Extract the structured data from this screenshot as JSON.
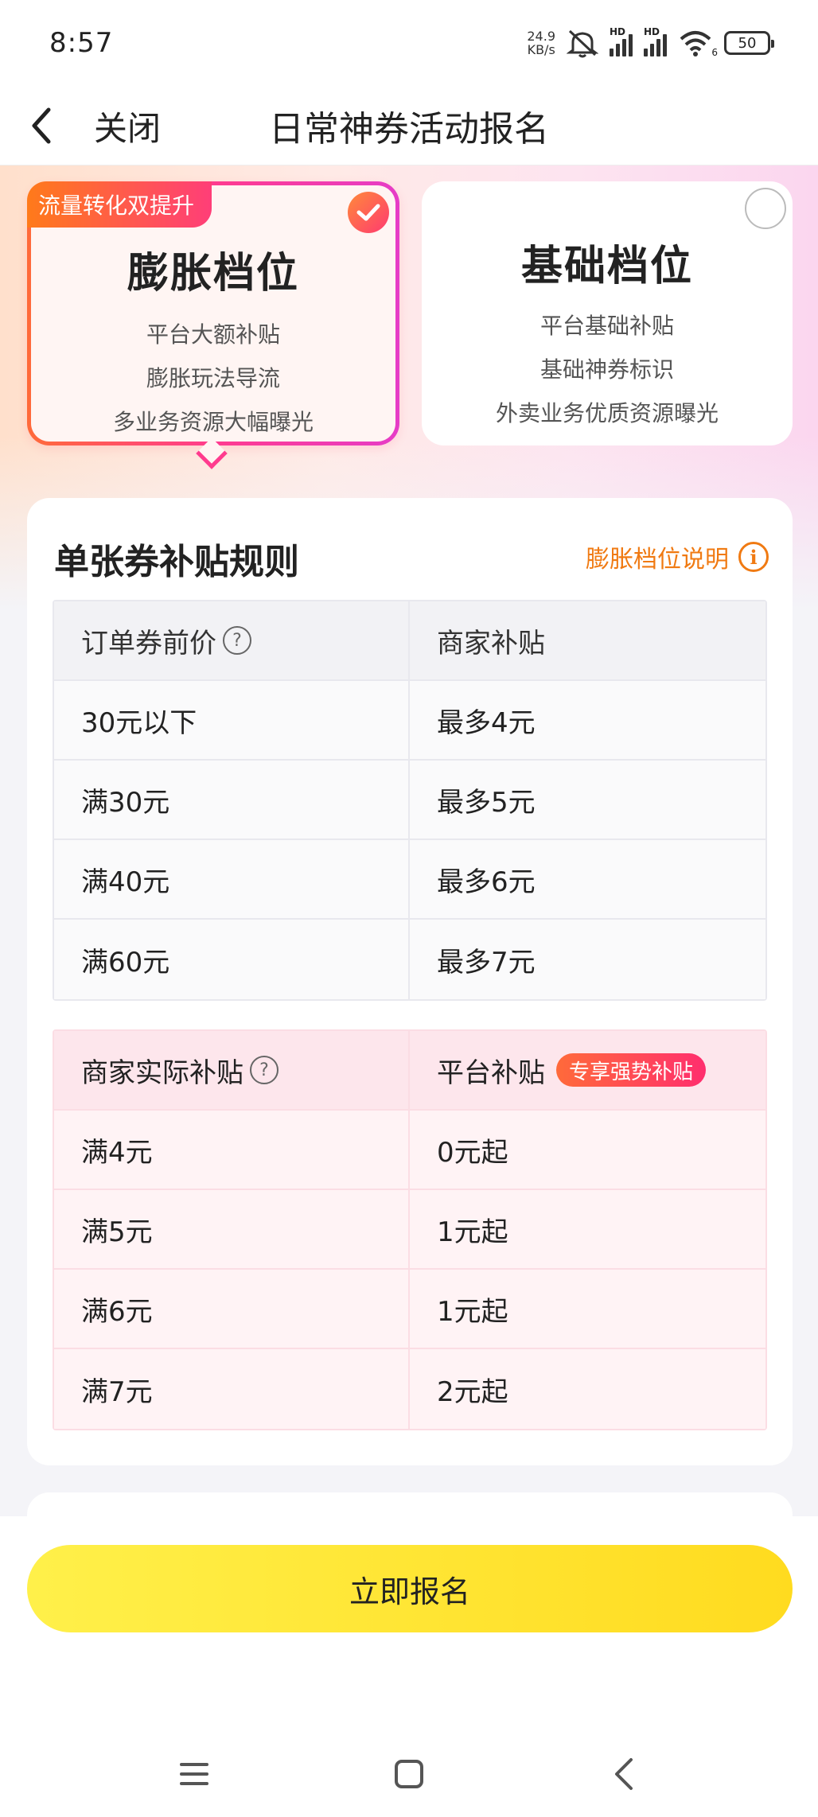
{
  "status_bar": {
    "time": "8:57",
    "net_speed_value": "24.9",
    "net_speed_unit": "KB/s",
    "hd1": "HD",
    "hd2": "HD",
    "wifi_label": "6",
    "battery": "50"
  },
  "nav": {
    "close_label": "关闭",
    "title": "日常神券活动报名"
  },
  "tiers": [
    {
      "badge": "流量转化双提升",
      "name": "膨胀档位",
      "selected": true,
      "features": [
        "平台大额补贴",
        "膨胀玩法导流",
        "多业务资源大幅曝光"
      ]
    },
    {
      "name": "基础档位",
      "selected": false,
      "features": [
        "平台基础补贴",
        "基础神券标识",
        "外卖业务优质资源曝光"
      ]
    }
  ],
  "rules": {
    "title": "单张券补贴规则",
    "link_label": "膨胀档位说明",
    "table1": {
      "headers": [
        "订单券前价",
        "商家补贴"
      ],
      "rows": [
        [
          "30元以下",
          "最多4元"
        ],
        [
          "满30元",
          "最多5元"
        ],
        [
          "满40元",
          "最多6元"
        ],
        [
          "满60元",
          "最多7元"
        ]
      ]
    },
    "table2": {
      "headers": [
        "商家实际补贴",
        "平台补贴"
      ],
      "tag": "专享强势补贴",
      "rows": [
        [
          "满4元",
          "0元起"
        ],
        [
          "满5元",
          "1元起"
        ],
        [
          "满6元",
          "1元起"
        ],
        [
          "满7元",
          "2元起"
        ]
      ]
    }
  },
  "cta": {
    "signup_label": "立即报名"
  },
  "colors": {
    "accent_orange": "#f07a12",
    "accent_pink": "#ff3b8e",
    "cta_yellow": "#ffdb1f"
  }
}
